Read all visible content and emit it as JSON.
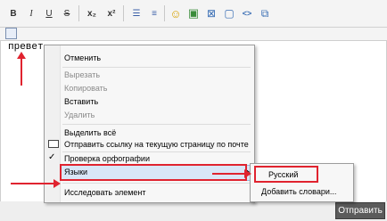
{
  "toolbar": {
    "buttons": [
      {
        "icon": "bold-icon",
        "glyph": "B"
      },
      {
        "icon": "italic-icon",
        "glyph": "I"
      },
      {
        "icon": "underline-icon",
        "glyph": "U"
      },
      {
        "icon": "strikethrough-icon",
        "glyph": "S"
      },
      {
        "icon": "subscript-icon",
        "glyph": "x₂"
      },
      {
        "icon": "superscript-icon",
        "glyph": "x²"
      },
      {
        "icon": "bulleted-list-icon",
        "glyph": "☰"
      },
      {
        "icon": "numbered-list-icon",
        "glyph": "≡"
      },
      {
        "icon": "smiley-icon",
        "glyph": "☺"
      },
      {
        "icon": "image-icon",
        "glyph": "▣"
      },
      {
        "icon": "link-icon",
        "glyph": "⊠"
      },
      {
        "icon": "quote-icon",
        "glyph": "▢"
      },
      {
        "icon": "code-icon",
        "glyph": "<>"
      },
      {
        "icon": "spoiler-icon",
        "glyph": "⧉"
      }
    ],
    "row2_icon": "source-icon"
  },
  "editor": {
    "text": "превет"
  },
  "context_menu": {
    "undo": "Отменить",
    "cut": "Вырезать",
    "copy": "Копировать",
    "paste": "Вставить",
    "delete": "Удалить",
    "select_all": "Выделить всё",
    "send_link": "Отправить ссылку на текущую страницу по почте",
    "spellcheck": "Проверка орфографии",
    "languages": "Языки",
    "inspect": "Исследовать элемент",
    "check_glyph": "✓"
  },
  "languages_submenu": {
    "russian": "Русский",
    "add_dictionaries": "Добавить словари..."
  },
  "submit_label": "Отправить",
  "colors": {
    "annotation_red": "#e0232f",
    "highlight_blue": "#d9e6f7",
    "button_dark": "#5b5b5b"
  }
}
